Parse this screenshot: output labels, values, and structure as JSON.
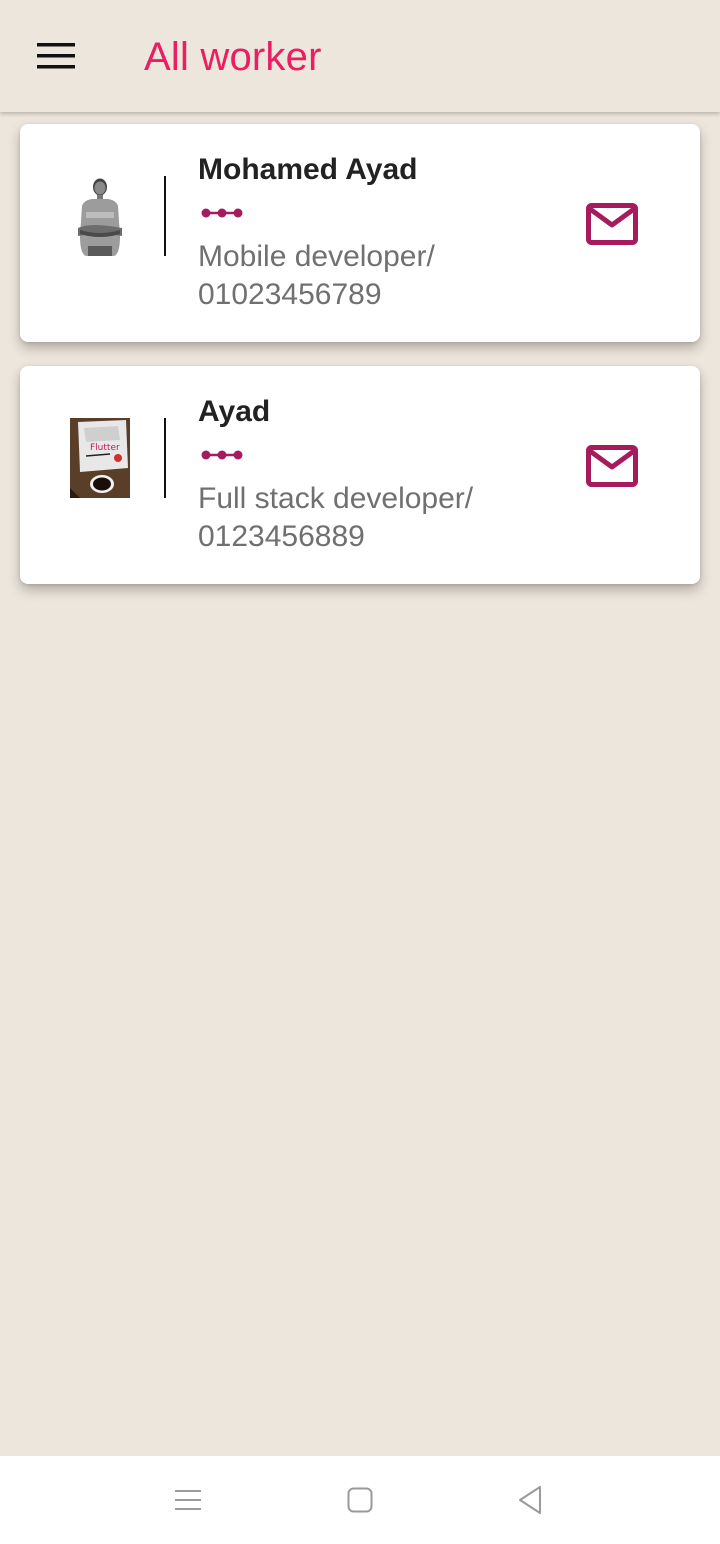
{
  "app_bar": {
    "title": "All worker",
    "title_color": "#E91E63",
    "menu_icon": "hamburger-menu-icon"
  },
  "accent_color": "#A61B5E",
  "workers": [
    {
      "name": "Mohamed Ayad",
      "info": "Mobile developer/ 01023456789",
      "avatar": "person-photo",
      "action_icon": "mail-icon",
      "status_icon": "dots-icon"
    },
    {
      "name": "Ayad",
      "info": "Full stack developer/ 0123456889",
      "avatar": "book-photo",
      "action_icon": "mail-icon",
      "status_icon": "dots-icon"
    }
  ],
  "system_nav": {
    "icons": [
      "recents-icon",
      "home-icon",
      "back-icon"
    ]
  }
}
